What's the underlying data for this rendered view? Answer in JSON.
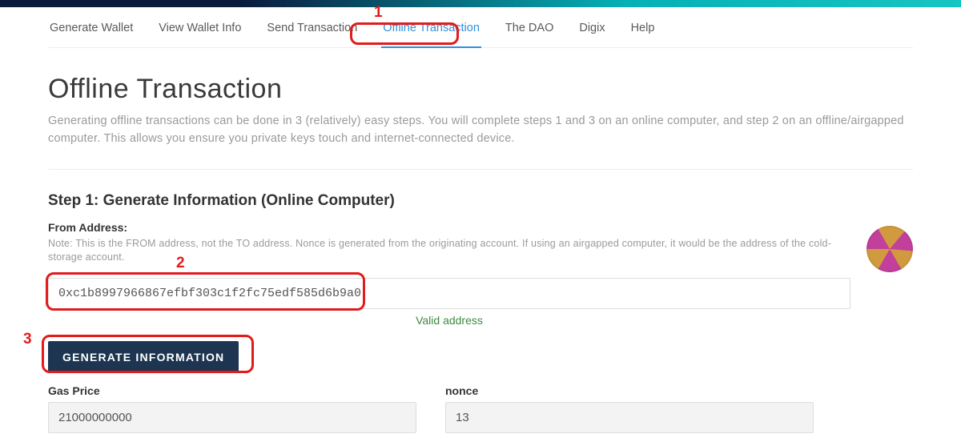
{
  "nav": {
    "tabs": [
      {
        "label": "Generate Wallet"
      },
      {
        "label": "View Wallet Info"
      },
      {
        "label": "Send Transaction"
      },
      {
        "label": "Offline Transaction",
        "active": true
      },
      {
        "label": "The DAO"
      },
      {
        "label": "Digix"
      },
      {
        "label": "Help"
      }
    ]
  },
  "page": {
    "title": "Offline Transaction",
    "description": "Generating offline transactions can be done in 3 (relatively) easy steps. You will complete steps 1 and 3 on an online computer, and step 2 on an offline/airgapped computer. This allows you ensure you private keys touch and internet-connected device."
  },
  "step1": {
    "title": "Step 1: Generate Information (Online Computer)",
    "from_label": "From Address:",
    "from_note": "Note: This is the FROM address, not the TO address. Nonce is generated from the originating account. If using an airgapped computer, it would be the address of the cold-storage account.",
    "from_value": "0xc1b8997966867efbf303c1f2fc75edf585d6b9a0",
    "valid_msg": "Valid address",
    "generate_btn": "GENERATE INFORMATION",
    "gas_label": "Gas Price",
    "gas_value": "21000000000",
    "nonce_label": "nonce",
    "nonce_value": "13"
  },
  "annotations": {
    "n1": "1",
    "n2": "2",
    "n3": "3"
  }
}
